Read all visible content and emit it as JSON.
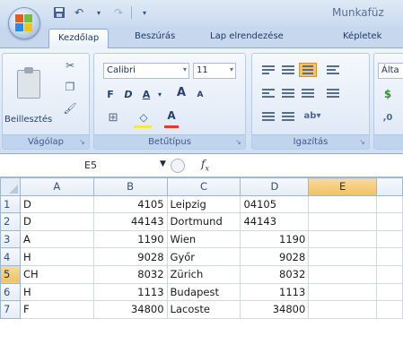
{
  "window": {
    "title": "Munkafüz"
  },
  "quick_access": [
    "save",
    "undo",
    "redo"
  ],
  "tabs": [
    {
      "label": "Kezdőlap",
      "active": true
    },
    {
      "label": "Beszúrás",
      "active": false
    },
    {
      "label": "Lap elrendezése",
      "active": false
    },
    {
      "label": "Képletek",
      "active": false
    }
  ],
  "ribbon": {
    "clipboard": {
      "paste_label": "Beillesztés",
      "group_label": "Vágólap"
    },
    "font": {
      "name": "Calibri",
      "size": "11",
      "bold": "F",
      "italic": "D",
      "underline": "A",
      "grow": "A",
      "shrink": "A",
      "color_a": "A",
      "group_label": "Betűtípus"
    },
    "alignment": {
      "group_label": "Igazítás"
    },
    "number": {
      "format": "Álta"
    }
  },
  "formula_bar": {
    "cell_ref": "E5",
    "fx": "fx",
    "content": ""
  },
  "grid": {
    "columns": [
      "A",
      "B",
      "C",
      "D",
      "E"
    ],
    "selected_column": "E",
    "selected_row": "5",
    "active_cell": "E5",
    "rows": [
      {
        "num": "1",
        "A": "D",
        "B": "4105",
        "C": "Leipzig",
        "D": "04105",
        "D_align": "left",
        "E": ""
      },
      {
        "num": "2",
        "A": "D",
        "B": "44143",
        "C": "Dortmund",
        "D": "44143",
        "D_align": "left",
        "E": ""
      },
      {
        "num": "3",
        "A": "A",
        "B": "1190",
        "C": "Wien",
        "D": "1190",
        "D_align": "right",
        "E": ""
      },
      {
        "num": "4",
        "A": "H",
        "B": "9028",
        "C": "Győr",
        "D": "9028",
        "D_align": "right",
        "E": ""
      },
      {
        "num": "5",
        "A": "CH",
        "B": "8032",
        "C": "Zürich",
        "D": "8032",
        "D_align": "right",
        "E": ""
      },
      {
        "num": "6",
        "A": "H",
        "B": "1113",
        "C": "Budapest",
        "D": "1113",
        "D_align": "right",
        "E": ""
      },
      {
        "num": "7",
        "A": "F",
        "B": "34800",
        "C": "Lacoste",
        "D": "34800",
        "D_align": "right",
        "E": ""
      }
    ]
  },
  "colors": {
    "accent": "#f1c15f",
    "ribbon": "#dde8f6",
    "grid_line": "#d0d7e5"
  }
}
